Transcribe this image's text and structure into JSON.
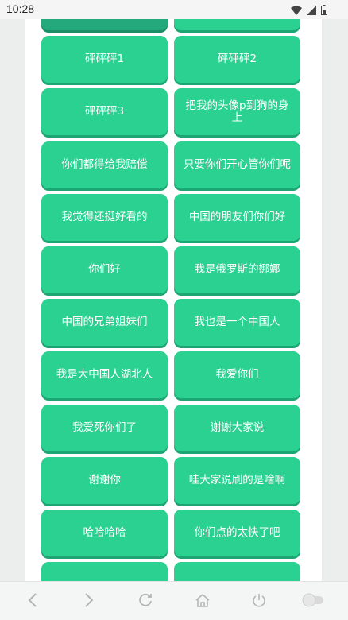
{
  "status_bar": {
    "time": "10:28",
    "icons": [
      "wifi-icon",
      "signal-icon",
      "battery-icon"
    ]
  },
  "colors": {
    "button": "#2ad191",
    "button_pressed": "#23a97c",
    "button_shadow": "#1da574",
    "panel": "#ffffff",
    "background": "#eceeed"
  },
  "buttons": [
    "",
    "",
    "砰砰砰1",
    "砰砰砰2",
    "砰砰砰3",
    "把我的头像p到狗的身上",
    "你们都得给我赔偿",
    "只要你们开心管你们呢",
    "我觉得还挺好看的",
    "中国的朋友们你们好",
    "你们好",
    "我是俄罗斯的娜娜",
    "中国的兄弟姐妹们",
    "我也是一个中国人",
    "我是大中国人湖北人",
    "我爱你们",
    "我爱死你们了",
    "谢谢大家说",
    "谢谢你",
    "哇大家说刷的是啥啊",
    "哈哈哈哈",
    "你们点的太快了吧",
    "",
    ""
  ],
  "bottom_nav": [
    "back-icon",
    "forward-icon",
    "refresh-icon",
    "home-icon",
    "power-icon",
    "toggle-switch"
  ]
}
